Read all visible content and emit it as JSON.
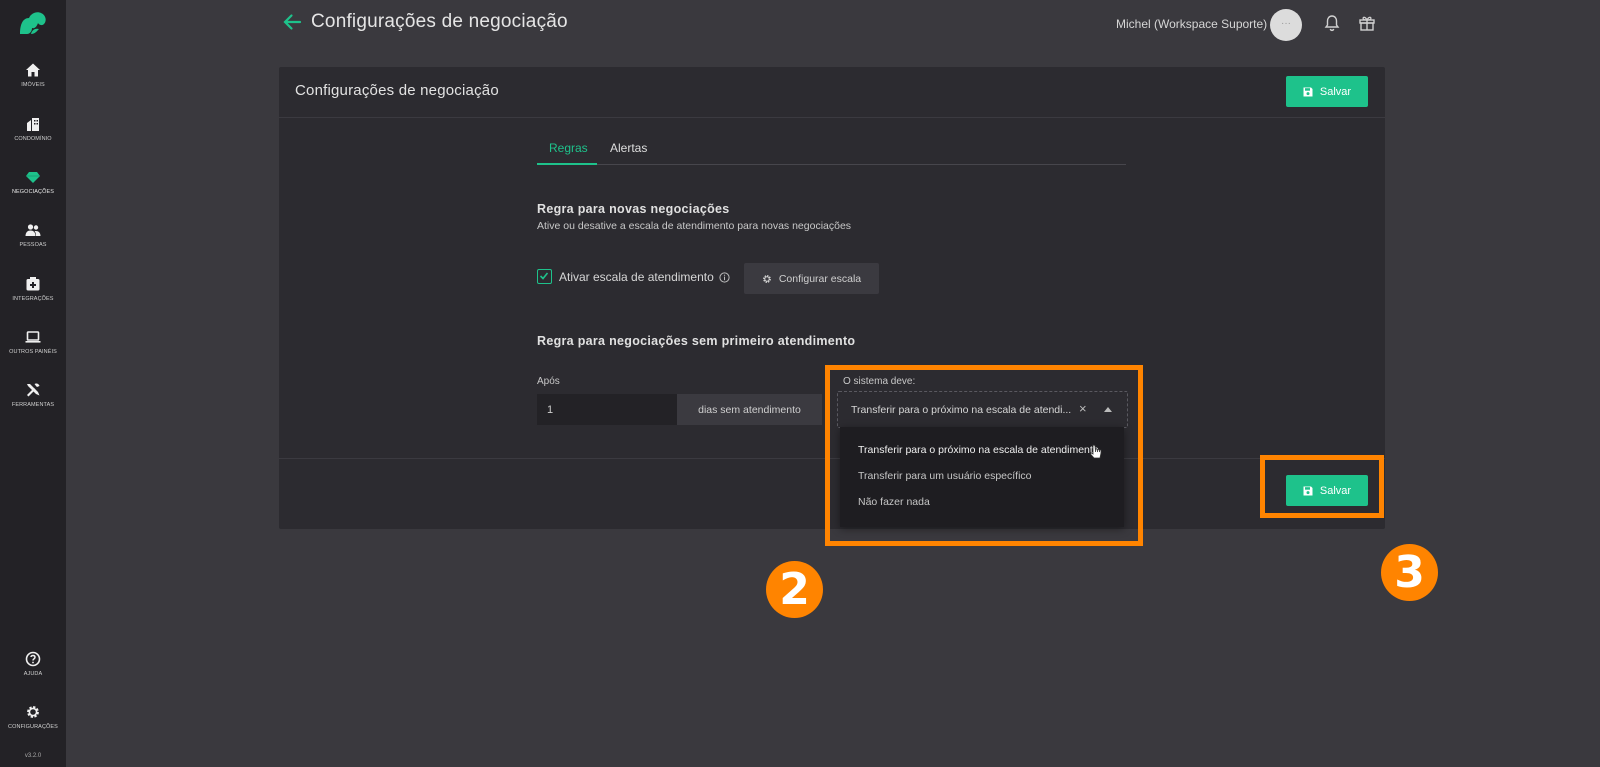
{
  "app": {
    "version": "v3.2.0"
  },
  "sidebar": {
    "items": [
      {
        "label": "IMÓVEIS",
        "icon": "home-icon"
      },
      {
        "label": "CONDOMÍNIO",
        "icon": "building-icon"
      },
      {
        "label": "NEGOCIAÇÕES",
        "icon": "diamond-icon",
        "active": true
      },
      {
        "label": "PESSOAS",
        "icon": "people-icon"
      },
      {
        "label": "INTEGRAÇÕES",
        "icon": "integration-icon"
      },
      {
        "label": "OUTROS PAINÉIS",
        "icon": "laptop-icon"
      },
      {
        "label": "FERRAMENTAS",
        "icon": "tools-icon"
      }
    ],
    "bottom_items": [
      {
        "label": "AJUDA",
        "icon": "help-icon"
      },
      {
        "label": "CONFIGURAÇÕES",
        "icon": "gear-icon"
      }
    ]
  },
  "header": {
    "title": "Configurações de negociação",
    "user_name": "Michel (Workspace Suporte)",
    "avatar_text": "···"
  },
  "card": {
    "title": "Configurações de negociação",
    "save_label": "Salvar",
    "tabs": [
      {
        "label": "Regras",
        "active": true
      },
      {
        "label": "Alertas",
        "active": false
      }
    ],
    "section1": {
      "title": "Regra para novas negociações",
      "subtitle": "Ative ou desative a escala de atendimento para novas negociações",
      "checkbox_label": "Ativar escala de atendimento",
      "checkbox_checked": true,
      "config_button": "Configurar escala"
    },
    "section2": {
      "title": "Regra para negociações sem primeiro atendimento",
      "after_label": "Após",
      "after_value": "1",
      "after_suffix": "dias sem atendimento",
      "system_label": "O sistema deve:",
      "selected_value": "Transferir para o próximo na escala de atendi...",
      "options": [
        "Transferir para o próximo na escala de atendimento",
        "Transferir para um usuário específico",
        "Não fazer nada"
      ]
    },
    "footer_save_label": "Salvar"
  },
  "annotations": {
    "step2": "2",
    "step3": "3"
  },
  "colors": {
    "accent": "#1ec28b",
    "annotation": "#ff8400",
    "background": "#3a393e",
    "sidebar": "#232226",
    "card": "#2c2b30"
  }
}
